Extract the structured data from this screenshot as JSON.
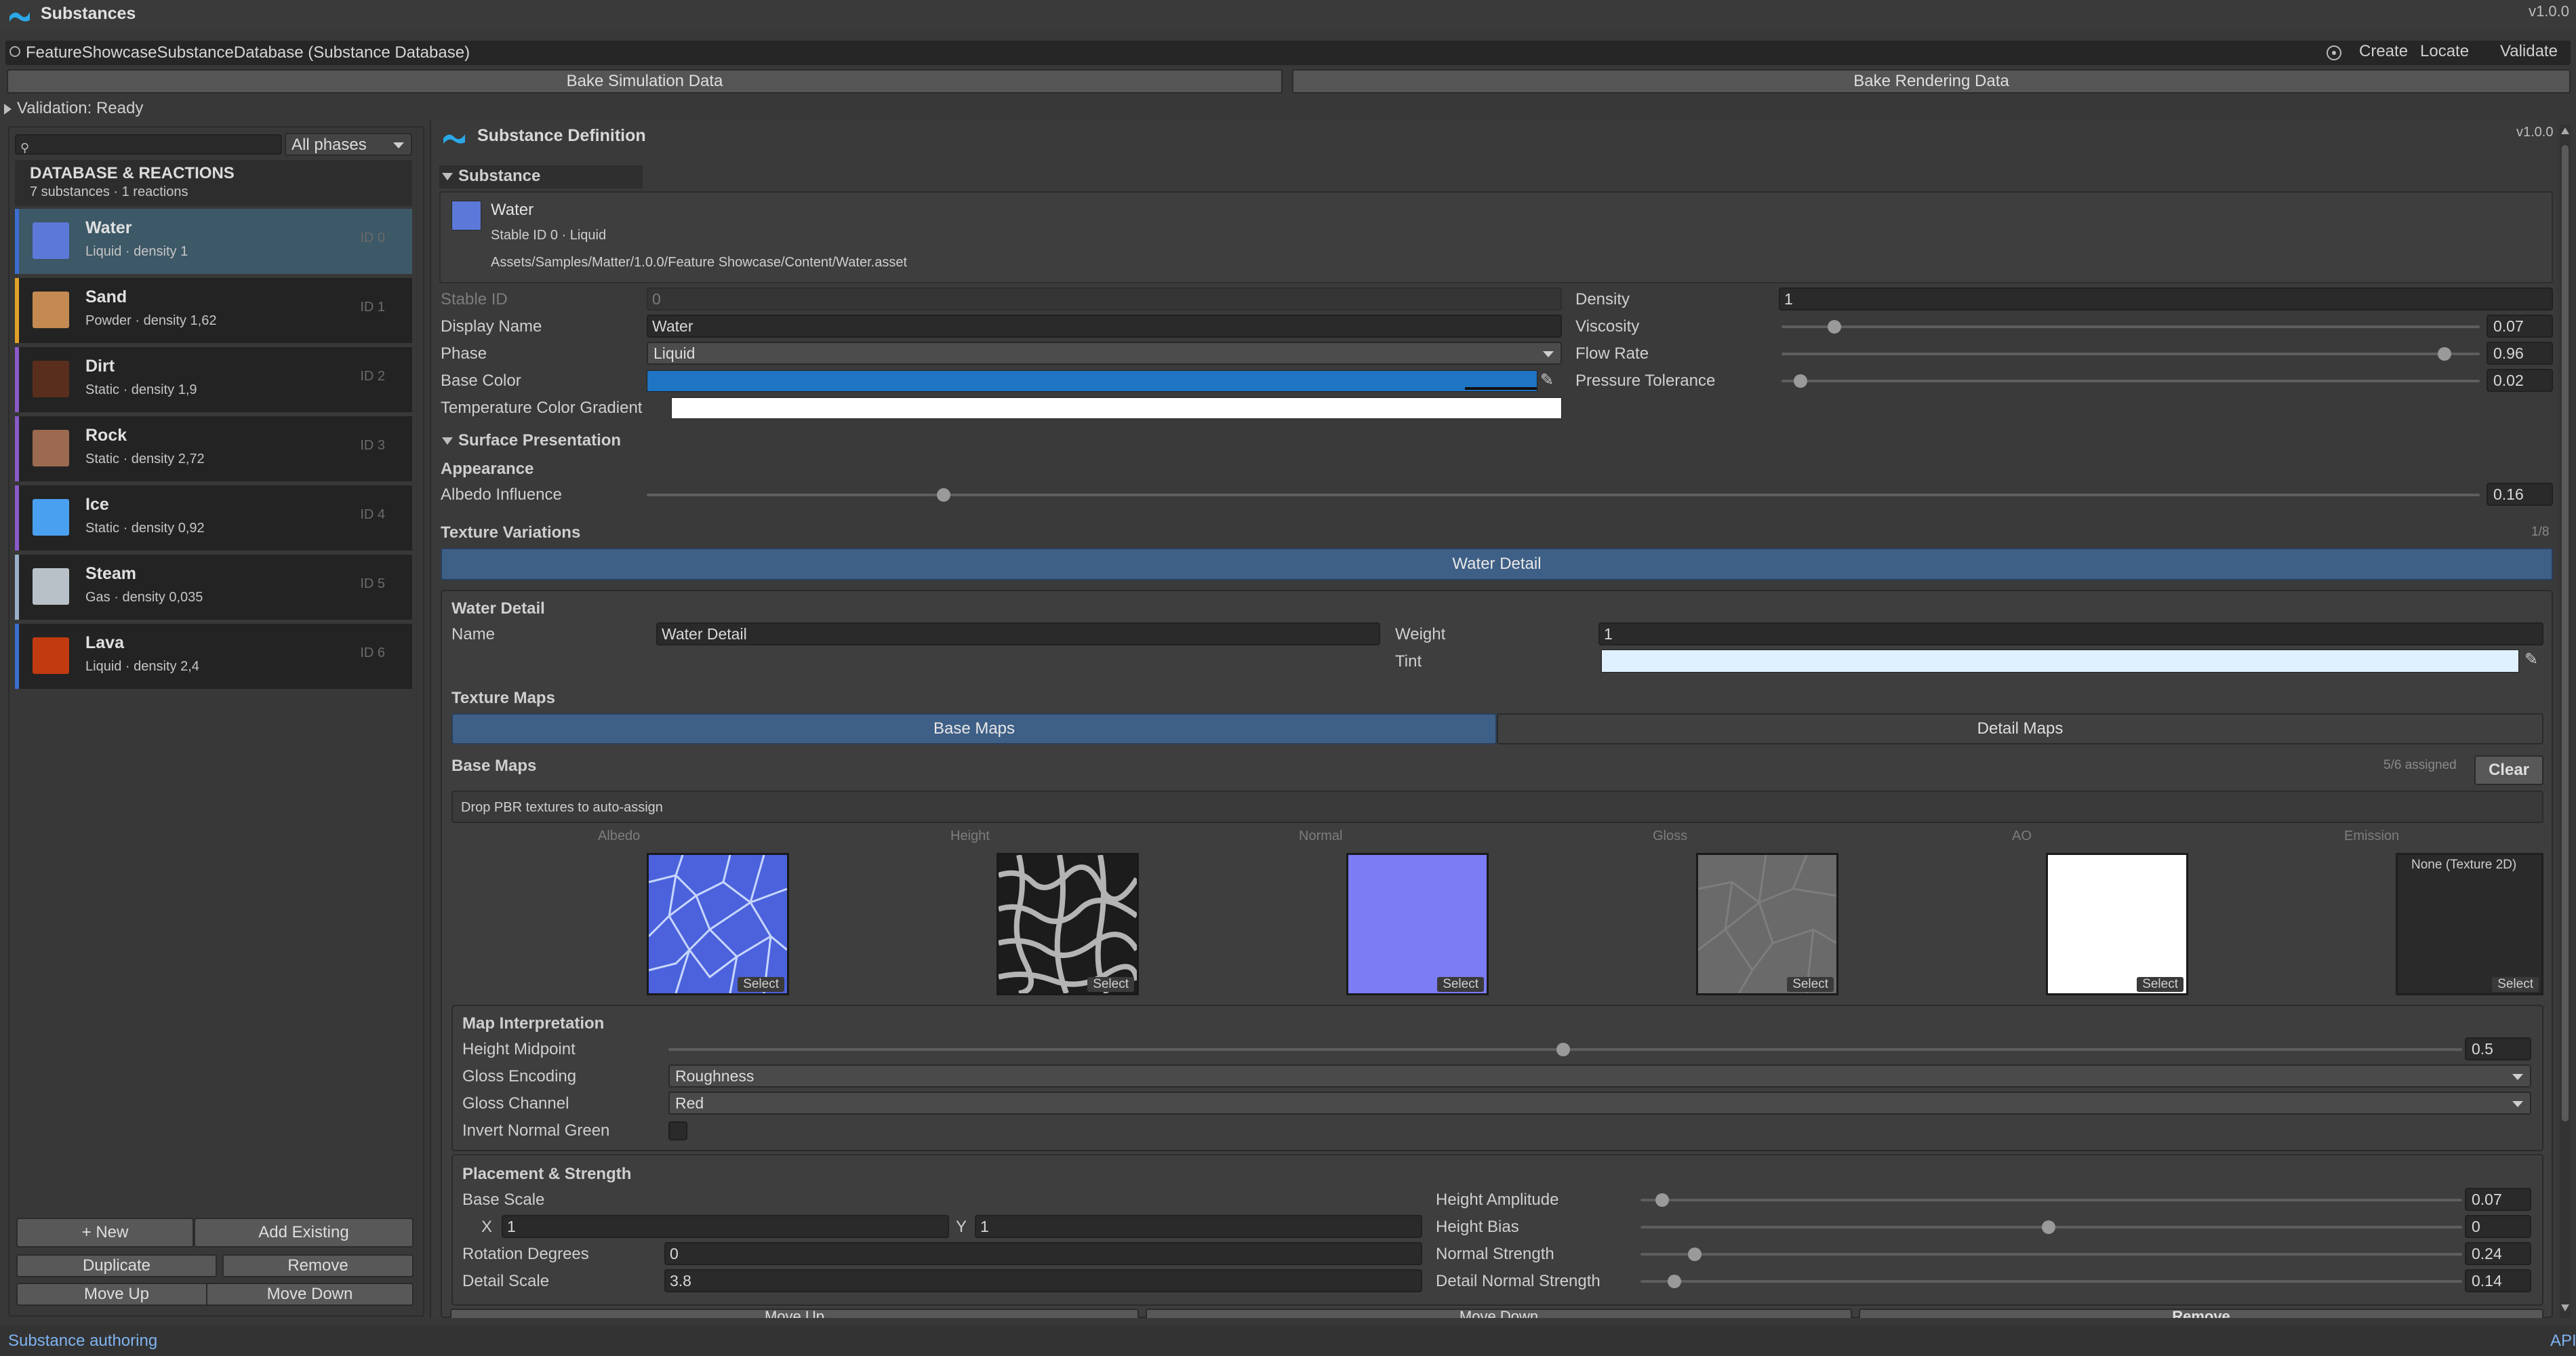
{
  "window": {
    "title": "Substances",
    "version": "v1.0.0"
  },
  "database_bar": {
    "path": "FeatureShowcaseSubstanceDatabase (Substance Database)",
    "create": "Create",
    "locate": "Locate",
    "validate": "Validate"
  },
  "bake": {
    "simulation": "Bake Simulation Data",
    "rendering": "Bake Rendering Data"
  },
  "validation": "Validation: Ready",
  "left": {
    "search_placeholder": "",
    "phase_filter": "All phases",
    "header_title": "DATABASE & REACTIONS",
    "header_sub": "7 substances · 1 reactions",
    "items": [
      {
        "name": "Water",
        "sub": "Liquid · density 1",
        "id": "ID 0",
        "color": "#5c78d8",
        "accent": "#3b6ecf"
      },
      {
        "name": "Sand",
        "sub": "Powder · density 1,62",
        "id": "ID 1",
        "color": "#c48a52",
        "accent": "#e0a12a"
      },
      {
        "name": "Dirt",
        "sub": "Static · density 1,9",
        "id": "ID 2",
        "color": "#5a2e1c",
        "accent": "#8a5ac8"
      },
      {
        "name": "Rock",
        "sub": "Static · density 2,72",
        "id": "ID 3",
        "color": "#9c6a50",
        "accent": "#8a5ac8"
      },
      {
        "name": "Ice",
        "sub": "Static · density 0,92",
        "id": "ID 4",
        "color": "#4aa0f0",
        "accent": "#8a5ac8"
      },
      {
        "name": "Steam",
        "sub": "Gas · density 0,035",
        "id": "ID 5",
        "color": "#b8c0c8",
        "accent": "#9ab0c8"
      },
      {
        "name": "Lava",
        "sub": "Liquid · density 2,4",
        "id": "ID 6",
        "color": "#c23a10",
        "accent": "#3b6ecf"
      }
    ],
    "buttons": {
      "new": "+ New",
      "add_existing": "Add Existing",
      "duplicate": "Duplicate",
      "remove": "Remove",
      "move_up": "Move Up",
      "move_down": "Move Down"
    }
  },
  "definition": {
    "title": "Substance Definition",
    "version": "v1.0.0",
    "substance_section": "Substance",
    "card": {
      "name": "Water",
      "line": "Stable ID 0 · Liquid",
      "path": "Assets/Samples/Matter/1.0.0/Feature Showcase/Content/Water.asset"
    },
    "fields": {
      "stable_id_label": "Stable ID",
      "stable_id": "0",
      "display_name_label": "Display Name",
      "display_name": "Water",
      "phase_label": "Phase",
      "phase": "Liquid",
      "base_color_label": "Base Color",
      "base_color": "#1f74c4",
      "gradient_label": "Temperature Color Gradient",
      "density_label": "Density",
      "density": "1",
      "viscosity_label": "Viscosity",
      "viscosity": "0.07",
      "flow_rate_label": "Flow Rate",
      "flow_rate": "0.96",
      "pressure_label": "Pressure Tolerance",
      "pressure": "0.02"
    },
    "surface": {
      "title": "Surface Presentation",
      "appearance": "Appearance",
      "albedo_label": "Albedo Influence",
      "albedo": "0.16"
    },
    "texture_variations": {
      "title": "Texture Variations",
      "count": "1/8",
      "selected_tab": "Water Detail",
      "detail_title": "Water Detail",
      "name_label": "Name",
      "name": "Water Detail",
      "weight_label": "Weight",
      "weight": "1",
      "tint_label": "Tint",
      "tint": "#dff1ff",
      "texture_maps": "Texture Maps",
      "tabs": [
        "Base Maps",
        "Detail Maps"
      ],
      "base_maps_title": "Base Maps",
      "assigned": "5/6 assigned",
      "clear": "Clear",
      "drop_hint": "Drop PBR textures to auto-assign",
      "maps": [
        {
          "label": "Albedo",
          "select": "Select"
        },
        {
          "label": "Height",
          "select": "Select"
        },
        {
          "label": "Normal",
          "select": "Select"
        },
        {
          "label": "Gloss",
          "select": "Select"
        },
        {
          "label": "AO",
          "select": "Select"
        },
        {
          "label": "Emission",
          "select": "Select",
          "empty": "None (Texture 2D)"
        }
      ]
    },
    "map_interp": {
      "title": "Map Interpretation",
      "height_midpoint_label": "Height Midpoint",
      "height_midpoint": "0.5",
      "gloss_encoding_label": "Gloss Encoding",
      "gloss_encoding": "Roughness",
      "gloss_channel_label": "Gloss Channel",
      "gloss_channel": "Red",
      "invert_label": "Invert Normal Green"
    },
    "placement": {
      "title": "Placement & Strength",
      "base_scale_label": "Base Scale",
      "x_label": "X",
      "x": "1",
      "y_label": "Y",
      "y": "1",
      "rotation_label": "Rotation Degrees",
      "rotation": "0",
      "detail_scale_label": "Detail Scale",
      "detail_scale": "3.8",
      "height_amp_label": "Height Amplitude",
      "height_amp": "0.07",
      "height_bias_label": "Height Bias",
      "height_bias": "0",
      "normal_strength_label": "Normal Strength",
      "normal_strength": "0.24",
      "detail_normal_label": "Detail Normal Strength",
      "detail_normal": "0.14"
    },
    "bottom_buttons": [
      "Move Up",
      "Move Down",
      "Remove"
    ]
  },
  "status": {
    "left": "Substance authoring",
    "right": "API"
  }
}
